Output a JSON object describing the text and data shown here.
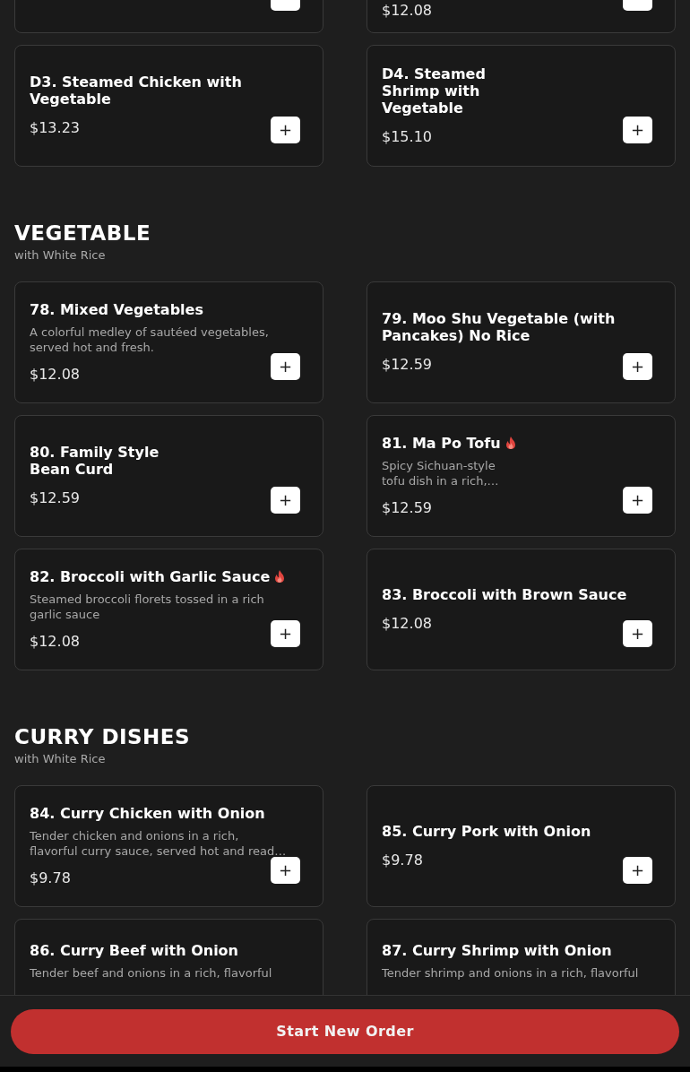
{
  "sections": [
    {
      "items": [
        {
          "kind": "cut_top"
        },
        {
          "kind": "cut_top",
          "price": "$12.08"
        },
        {
          "title": "D3. Steamed Chicken with Vegetable",
          "price": "$13.23",
          "add": "+"
        },
        {
          "title": "D4. Steamed\nShrimp with\nVegetable",
          "price": "$15.10",
          "add": "+"
        }
      ]
    },
    {
      "heading": "VEGETABLE",
      "subheading": "with White Rice",
      "items": [
        {
          "title": "78. Mixed Vegetables",
          "description": "A colorful medley of sautéed vegetables,\nserved hot and fresh.",
          "price": "$12.08",
          "add": "+"
        },
        {
          "title": "79. Moo Shu Vegetable (with\nPancakes) No Rice",
          "price": "$12.59",
          "add": "+"
        },
        {
          "title": "80. Family Style\nBean Curd",
          "price": "$12.59",
          "add": "+"
        },
        {
          "title": "81. Ma Po Tofu",
          "spicy": true,
          "description": "Spicy Sichuan-style\ntofu dish in a rich,…",
          "price": "$12.59",
          "add": "+"
        },
        {
          "title": "82. Broccoli with Garlic Sauce",
          "spicy": true,
          "description": "Steamed broccoli florets tossed in a rich\ngarlic sauce",
          "price": "$12.08",
          "add": "+"
        },
        {
          "title": "83. Broccoli with Brown Sauce",
          "price": "$12.08",
          "add": "+"
        }
      ]
    },
    {
      "heading": "CURRY DISHES",
      "subheading": "with White Rice",
      "items": [
        {
          "title": "84. Curry Chicken with Onion",
          "description": "Tender chicken and onions in a rich,\nflavorful curry sauce, served hot and read…",
          "price": "$9.78",
          "add": "+"
        },
        {
          "title": "85. Curry Pork with Onion",
          "price": "$9.78",
          "add": "+"
        },
        {
          "kind": "cut_bottom",
          "title": "86. Curry Beef with Onion",
          "description": "Tender beef and onions in a rich, flavorful"
        },
        {
          "kind": "cut_bottom",
          "title": "87. Curry Shrimp with Onion",
          "description": "Tender shrimp and onions in a rich, flavorful"
        }
      ]
    }
  ],
  "footer": {
    "button": "Start New Order"
  }
}
